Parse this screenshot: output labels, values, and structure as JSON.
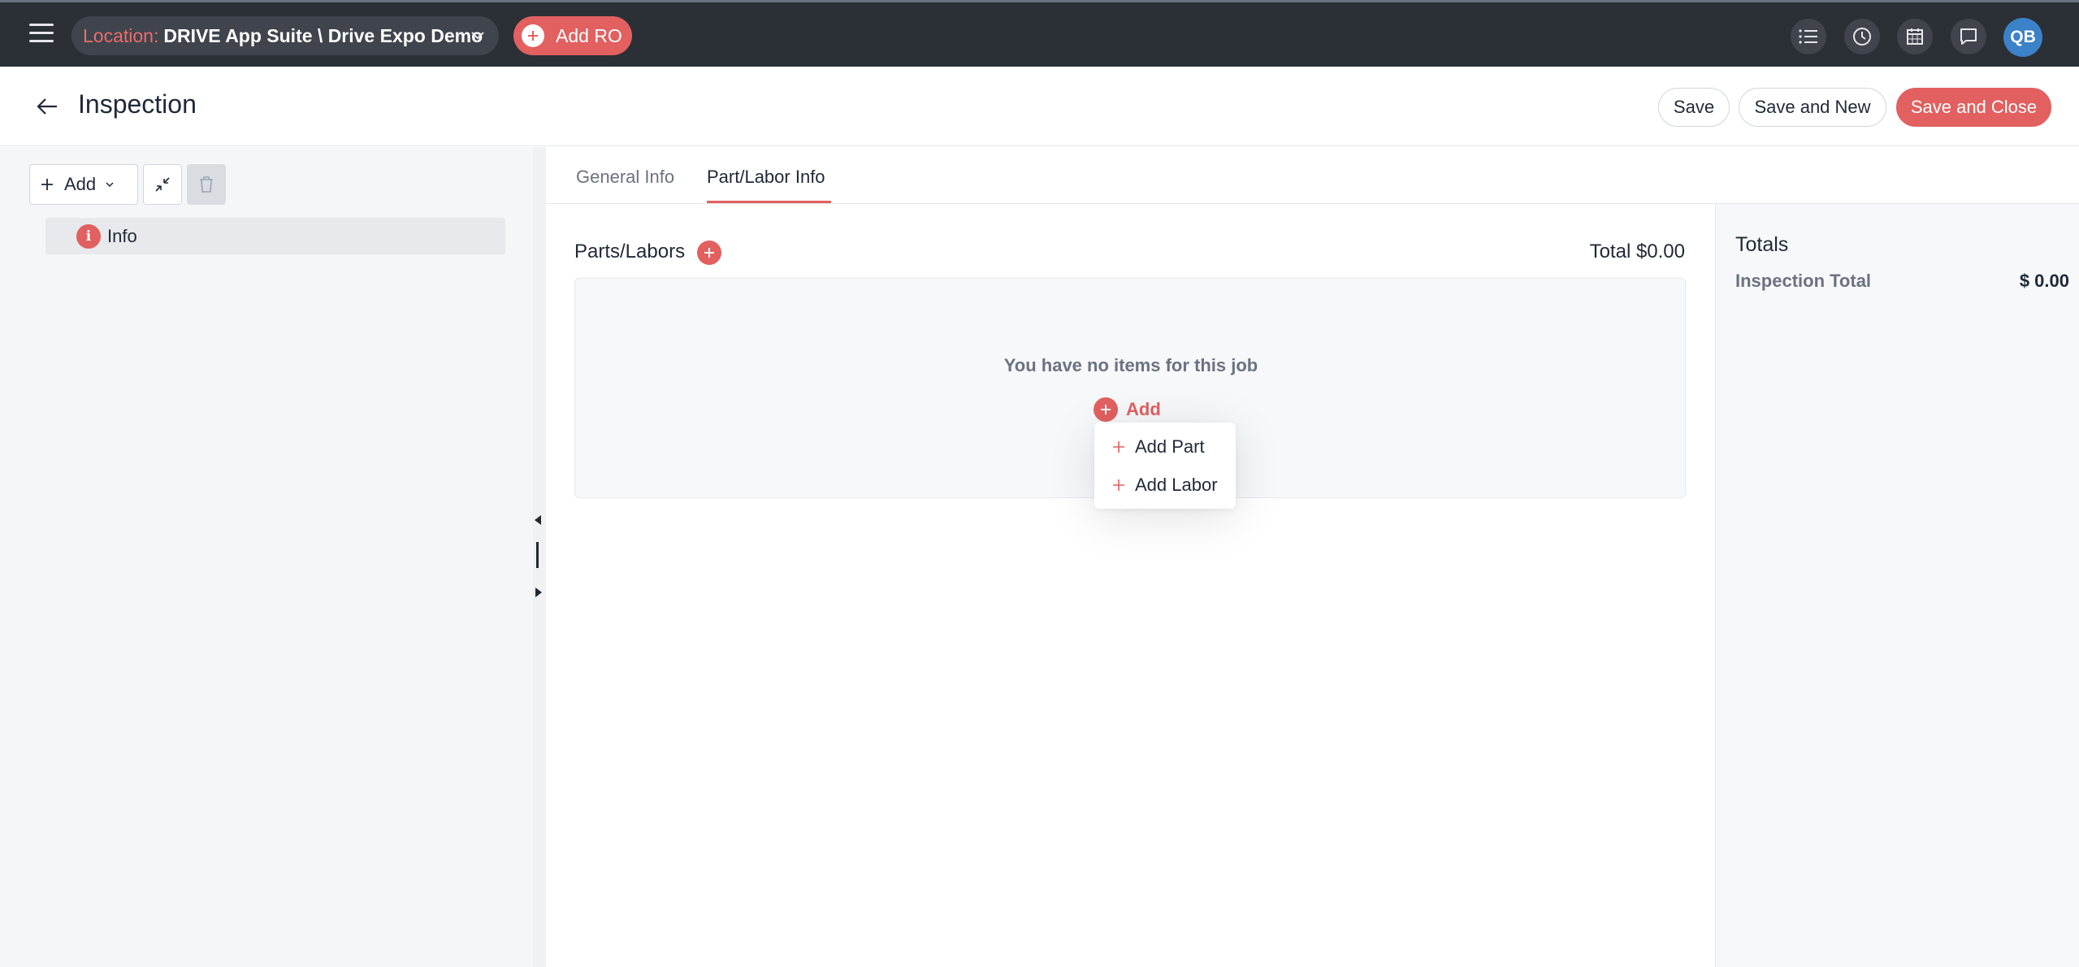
{
  "topbar": {
    "location_label": "Location:",
    "location_value": "DRIVE App Suite \\ Drive Expo Demo",
    "add_ro_label": "Add RO",
    "avatar_initials": "QB",
    "icons": [
      "list-icon",
      "clock-icon",
      "calendar-icon",
      "chat-icon"
    ]
  },
  "header": {
    "title": "Inspection",
    "save_label": "Save",
    "save_new_label": "Save and New",
    "save_close_label": "Save and Close"
  },
  "sidebar": {
    "add_label": "Add",
    "items": [
      {
        "label": "Info",
        "icon": "info-icon"
      }
    ]
  },
  "tabs": [
    {
      "label": "General Info",
      "active": false
    },
    {
      "label": "Part/Labor Info",
      "active": true
    }
  ],
  "parts": {
    "title": "Parts/Labors",
    "total_label": "Total $0.00",
    "empty_text": "You have no items for this job",
    "add_label": "Add",
    "menu": [
      {
        "label": "Add Part"
      },
      {
        "label": "Add Labor"
      }
    ]
  },
  "totals": {
    "title": "Totals",
    "rows": [
      {
        "label": "Inspection Total",
        "value": "$ 0.00"
      }
    ]
  },
  "colors": {
    "accent": "#e26060",
    "topbar": "#2b2f36",
    "avatar": "#3b82c8"
  }
}
